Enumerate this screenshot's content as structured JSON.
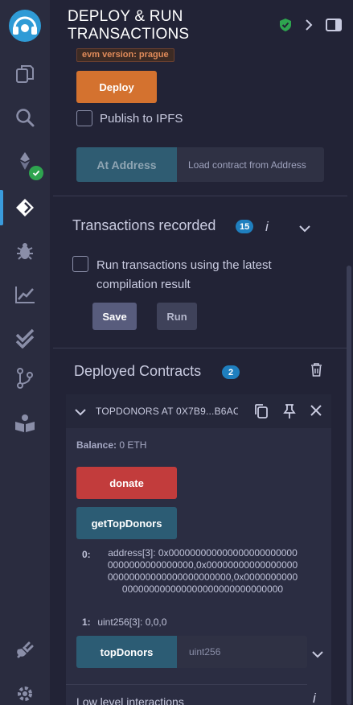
{
  "rail": {
    "items": [
      {
        "name": "remix-logo-icon"
      },
      {
        "name": "file-explorer-icon"
      },
      {
        "name": "search-icon"
      },
      {
        "name": "solidity-compiler-icon"
      },
      {
        "name": "deploy-run-icon"
      },
      {
        "name": "debugger-icon"
      },
      {
        "name": "analytics-icon"
      },
      {
        "name": "test-icon"
      },
      {
        "name": "git-icon"
      },
      {
        "name": "learneth-icon"
      },
      {
        "name": "plugin-manager-icon"
      },
      {
        "name": "settings-icon"
      }
    ],
    "active_color": "#3a9bdc"
  },
  "header": {
    "title_line1": "DEPLOY & RUN",
    "title_line2": "TRANSACTIONS",
    "icons": [
      "shield-check-icon",
      "chevron-right-icon",
      "panel-toggle-icon"
    ]
  },
  "deploy": {
    "evm_badge": "evm version: prague",
    "deploy_label": "Deploy",
    "deploy_color": "#d4722f",
    "publish_ipfs_label": "Publish to IPFS",
    "at_address_label": "At Address",
    "load_contract_placeholder": "Load contract from Address"
  },
  "transactions": {
    "title": "Transactions recorded",
    "count": "15",
    "info_glyph": "i",
    "run_latest_label_1": "Run transactions using the latest",
    "run_latest_label_2": "compilation result",
    "save_label": "Save",
    "run_label": "Run"
  },
  "deployed": {
    "title": "Deployed Contracts",
    "count": "2",
    "contract": {
      "title": "TOPDONORS AT 0X7B9...B6AC",
      "balance_label": "Balance:",
      "balance_value": "0 ETH",
      "functions": {
        "donate": "donate",
        "getTopDonors": "getTopDonors",
        "topDonors": "topDonors"
      },
      "outputs": [
        {
          "index": "0:",
          "value": "address[3]: 0x0000000000000000000000000000000000000000,0x0000000000000000000000000000000000000000,0x0000000000000000000000000000000000000000"
        },
        {
          "index": "1:",
          "value": "uint256[3]: 0,0,0"
        }
      ],
      "topDonors_placeholder": "uint256"
    }
  },
  "low_level": {
    "label": "Low level interactions",
    "info_glyph": "i"
  },
  "colors": {
    "bg": "#222336",
    "rail": "#2a2c3f",
    "donate": "#c23c3c",
    "call": "#2c5c74",
    "badge": "#1f7fbf"
  }
}
